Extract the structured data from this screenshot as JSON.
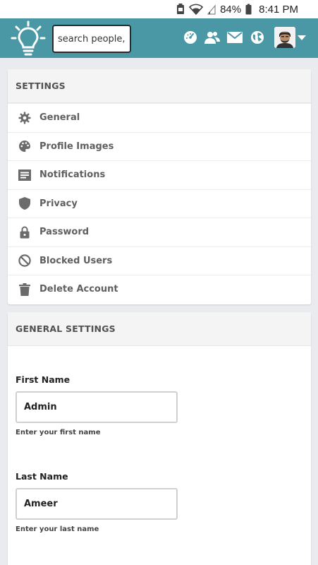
{
  "status_bar": {
    "battery_percent": "84%",
    "time": "8:41 PM"
  },
  "app_bar": {
    "search": {
      "placeholder": "search people,"
    },
    "icons": [
      "lightbulb-logo-icon",
      "dashboard-icon",
      "friends-icon",
      "mail-icon",
      "globe-icon"
    ],
    "accent_color": "#4a98a6"
  },
  "settings_menu": {
    "title": "SETTINGS",
    "items": [
      {
        "label": "General",
        "icon": "gear-icon"
      },
      {
        "label": "Profile Images",
        "icon": "palette-icon"
      },
      {
        "label": "Notifications",
        "icon": "notifications-icon"
      },
      {
        "label": "Privacy",
        "icon": "shield-icon"
      },
      {
        "label": "Password",
        "icon": "lock-icon"
      },
      {
        "label": "Blocked Users",
        "icon": "block-icon"
      },
      {
        "label": "Delete Account",
        "icon": "trash-icon"
      }
    ]
  },
  "general_settings": {
    "title": "GENERAL SETTINGS",
    "first_name": {
      "label": "First Name",
      "value": "Admin",
      "help": "Enter your first name"
    },
    "last_name": {
      "label": "Last Name",
      "value": "Ameer",
      "help": "Enter your last name"
    }
  }
}
